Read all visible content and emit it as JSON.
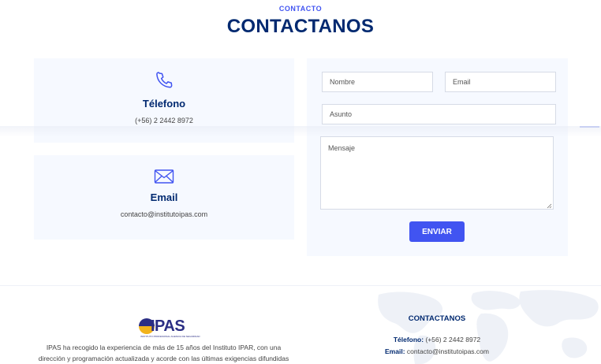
{
  "section": {
    "subtitle": "CONTACTO",
    "title": "CONTACTANOS"
  },
  "info": {
    "phone": {
      "icon": "phone-icon",
      "title": "Télefono",
      "value": "(+56) 2 2442 8972"
    },
    "email": {
      "icon": "envelope-icon",
      "title": "Email",
      "value": "contacto@institutoipas.com"
    }
  },
  "form": {
    "name_placeholder": "Nombre",
    "email_placeholder": "Email",
    "subject_placeholder": "Asunto",
    "message_placeholder": "Mensaje",
    "submit_label": "ENVIAR"
  },
  "footer": {
    "logo_text": "IPAS",
    "logo_tagline": "INSTITUTO PROFESIONAL AGENCIA DE SEGURIDAD",
    "about_line1": "IPAS ha recogido la experiencia de más de 15 años del Instituto IPAR, con una",
    "about_line2": "dirección y programación actualizada y acorde con las últimas exigencias difundidas",
    "contact_title": "CONTACTANOS",
    "phone_label": "Télefono:",
    "phone_value": "(+56) 2 2442 8972",
    "email_label": "Email:",
    "email_value": "contacto@institutoipas.com"
  },
  "colors": {
    "accent": "#4154f1",
    "heading": "#012970",
    "panel": "#f6f9ff"
  }
}
